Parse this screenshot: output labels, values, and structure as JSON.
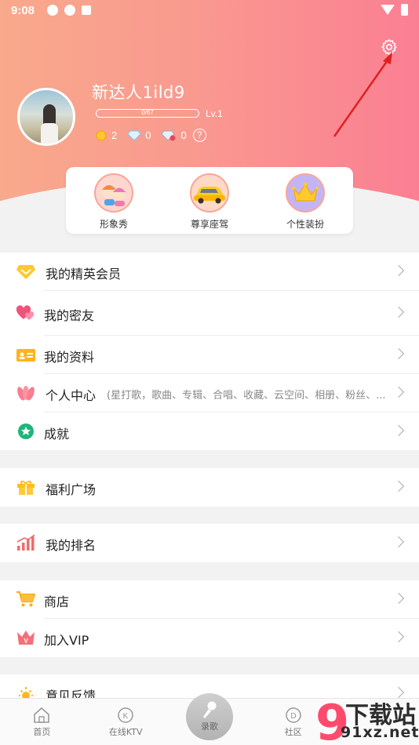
{
  "status_bar": {
    "time": "9:08"
  },
  "profile": {
    "username": "新达人1ild9",
    "exp": "0/67",
    "level": "Lv.1",
    "coins": "2",
    "diamonds": "0",
    "red_diamonds": "0",
    "help": "?"
  },
  "quick": [
    {
      "label": "形象秀",
      "icon": "couple-avatar-icon"
    },
    {
      "label": "尊享座驾",
      "icon": "car-icon"
    },
    {
      "label": "个性装扮",
      "icon": "crown-icon"
    }
  ],
  "menu": {
    "elite_member": "我的精英会员",
    "close_friends": "我的密友",
    "my_profile": "我的资料",
    "personal_center": "个人中心",
    "personal_center_sub": "(星打歌，歌曲、专辑、合唱、收藏、云空间、相册、粉丝、...",
    "achievements": "成就",
    "welfare": "福利广场",
    "ranking": "我的排名",
    "shop": "商店",
    "join_vip": "加入VIP",
    "feedback": "意见反馈"
  },
  "bottom_nav": {
    "home": "首页",
    "online_ktv": "在线KTV",
    "record": "录歌",
    "community": "社区"
  },
  "watermark": {
    "line1": "下载站",
    "line2": "91xz.net",
    "number": "91"
  },
  "colors": {
    "header_start": "#f9a98c",
    "header_end": "#fb7f93",
    "arrow": "#e02020"
  }
}
